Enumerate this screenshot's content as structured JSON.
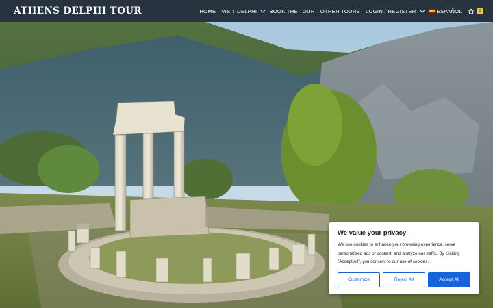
{
  "site": {
    "brand": "Athens Delphi Tour"
  },
  "nav": {
    "items": [
      {
        "label": "Home",
        "dropdown": false
      },
      {
        "label": "Visit Delphi",
        "dropdown": true
      },
      {
        "label": "Book the Tour",
        "dropdown": false
      },
      {
        "label": "Other Tours",
        "dropdown": false
      },
      {
        "label": "Login / Register",
        "dropdown": true
      }
    ],
    "language": {
      "label": "Español",
      "flag_icon": "spain-flag-icon"
    },
    "cart": {
      "icon": "cart-icon",
      "count": "0"
    }
  },
  "hero": {
    "image": "delphi-tholos-of-athena-pronaia-photo"
  },
  "cookie_banner": {
    "title": "We value your privacy",
    "message": "We use cookies to enhance your browsing experience, serve personalized ads or content, and analyze our traffic. By clicking \"Accept All\", you consent to our use of cookies.",
    "buttons": {
      "customize": "Customize",
      "reject": "Reject All",
      "accept": "Accept All"
    }
  },
  "colors": {
    "nav_background": "#222b38",
    "button_blue": "#1863dc",
    "cart_badge": "#f5c542"
  }
}
